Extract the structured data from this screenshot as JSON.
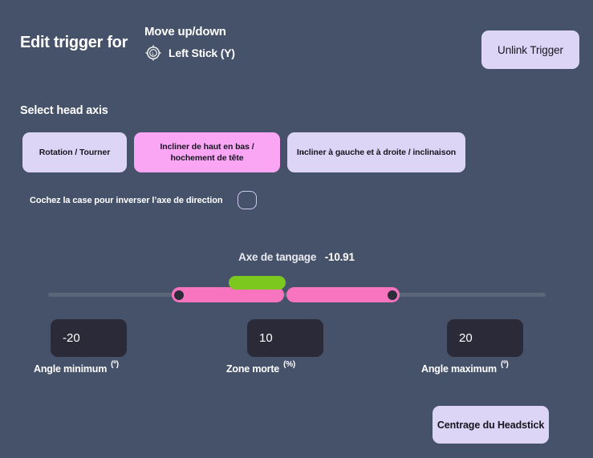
{
  "header": {
    "title": "Edit trigger for",
    "action_name": "Move up/down",
    "control_icon": "left-stick-icon",
    "control_label": "Left Stick (Y)",
    "unlink_label": "Unlink Trigger"
  },
  "head_axis": {
    "section_title": "Select head axis",
    "options": [
      {
        "label": "Rotation / Tourner",
        "selected": false
      },
      {
        "label": "Incliner de haut en bas / hochement de tête",
        "selected": true
      },
      {
        "label": "Incliner à gauche et à droite / inclinaison",
        "selected": false
      }
    ]
  },
  "invert": {
    "label": "Cochez la case pour inverser l’axe de direction",
    "checked": false
  },
  "slider": {
    "axis_label": "Axe de tangage",
    "axis_value": "-10.91",
    "min_handle_percent": 25,
    "max_handle_percent": 68
  },
  "values": {
    "min": {
      "value": "-20",
      "caption": "Angle minimum",
      "unit": "(º)"
    },
    "deadzone": {
      "value": "10",
      "caption": "Zone morte",
      "unit": "(%)"
    },
    "max": {
      "value": "20",
      "caption": "Angle maximum",
      "unit": "(º)"
    }
  },
  "footer": {
    "center_label": "Centrage du Headstick"
  },
  "colors": {
    "background": "#46526a",
    "accent_lavender": "#ddd5f5",
    "accent_pink": "#fba6f5",
    "slider_pink": "#f974bf",
    "indicator_green": "#7cc81f",
    "input_dark": "#2a2a38"
  }
}
